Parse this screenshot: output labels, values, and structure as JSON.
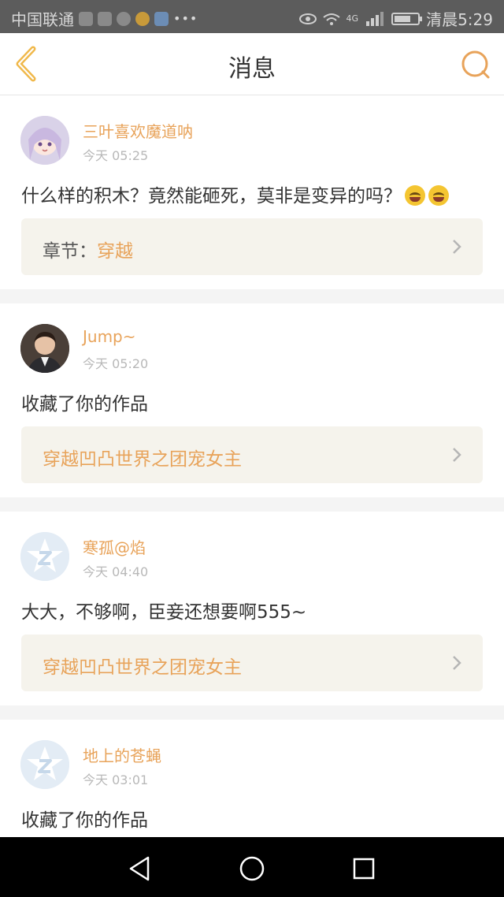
{
  "status_bar": {
    "carrier": "中国联通",
    "network": "4G",
    "clock": "清晨5:29",
    "battery_level": 0.7,
    "icons": [
      "carrier-app-icon",
      "message-icon",
      "wechat-icon",
      "coin-icon",
      "gallery-icon",
      "more-dots-icon",
      "eye-icon",
      "wifi-icon",
      "signal-icon",
      "battery-icon"
    ]
  },
  "nav": {
    "title": "消息",
    "back_icon": "chevron-left-icon",
    "search_icon": "search-icon",
    "accent_color": "#e8a35a"
  },
  "colors": {
    "name": "#e8a35a",
    "ref_text": "#e8a35a",
    "ref_bg": "#f5f3ec",
    "separator": "#f4f4f4"
  },
  "messages": [
    {
      "name": "三叶喜欢魔道呐",
      "time": "今天 05:25",
      "text": "什么样的积木？竟然能砸死，莫非是变异的吗？",
      "emoji_count": 2,
      "ref_prefix": "章节：",
      "ref_title": "穿越"
    },
    {
      "name": "Jump~",
      "time": "今天 05:20",
      "text": "收藏了你的作品",
      "ref_prefix": "",
      "ref_title": "穿越凹凸世界之团宠女主"
    },
    {
      "name": "寒孤@焰",
      "time": "今天 04:40",
      "text": "大大，不够啊，臣妾还想要啊555~",
      "ref_prefix": "",
      "ref_title": "穿越凹凸世界之团宠女主"
    },
    {
      "name": "地上的苍蝇",
      "time": "今天 03:01",
      "text": "收藏了你的作品"
    }
  ],
  "system_nav": {
    "buttons": [
      "back-triangle-icon",
      "home-circle-icon",
      "recents-square-icon"
    ]
  }
}
